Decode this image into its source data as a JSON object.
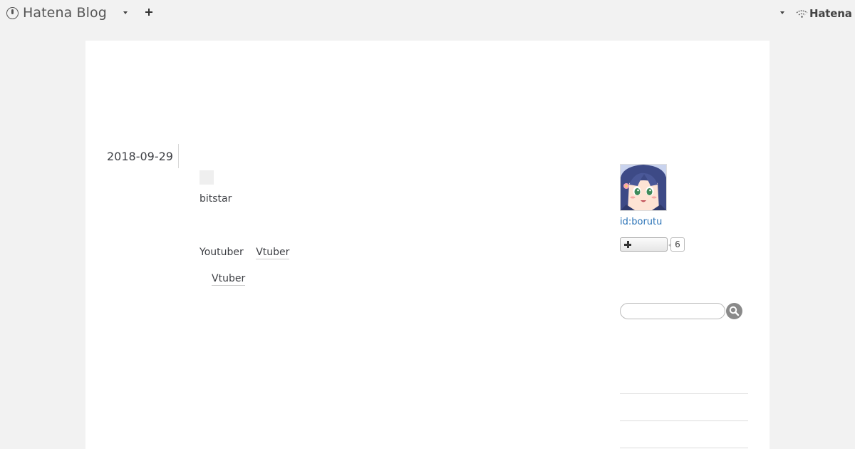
{
  "header": {
    "logo_text": "Hatena Blog",
    "brand_text": "Hatena",
    "icons": [
      "hatena-blog-logo-icon",
      "chevron-down-icon",
      "plus-icon",
      "hatena-wifi-icon"
    ]
  },
  "entry": {
    "date": "2018-09-29",
    "title": "bitstar",
    "tags_row1": {
      "plain": "Youtuber",
      "link": "Vtuber"
    },
    "tags_row2": {
      "link": "Vtuber"
    }
  },
  "sidebar": {
    "profile_id": "id:borutu",
    "follow_count": "6",
    "search_placeholder": ""
  },
  "colors": {
    "background": "#f2f2f2",
    "content_bg": "#ffffff",
    "link": "#2b73b7",
    "text": "#3d3f44"
  }
}
